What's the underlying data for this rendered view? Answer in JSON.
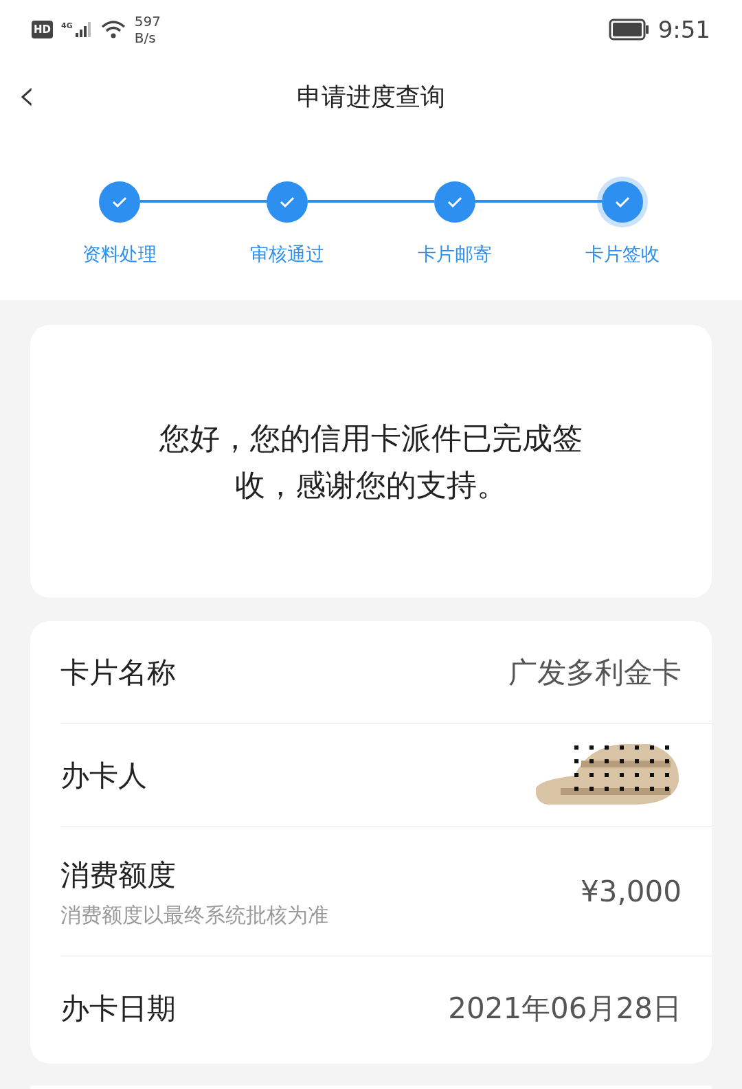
{
  "status_bar": {
    "hd": "HD",
    "network": "4G",
    "speed": "597",
    "speed_unit": "B/s",
    "time": "9:51"
  },
  "header": {
    "back": "‹",
    "title": "申请进度查询"
  },
  "steps": [
    {
      "label": "资料处理",
      "done": true,
      "current": false
    },
    {
      "label": "审核通过",
      "done": true,
      "current": false
    },
    {
      "label": "卡片邮寄",
      "done": true,
      "current": false
    },
    {
      "label": "卡片签收",
      "done": true,
      "current": true
    }
  ],
  "message": "您好，您的信用卡派件已完成签收，感谢您的支持。",
  "details": [
    {
      "kind": "text",
      "label": "卡片名称",
      "value": "广发多利金卡"
    },
    {
      "kind": "redacted",
      "label": "办卡人"
    },
    {
      "kind": "text",
      "label": "消费额度",
      "note": "消费额度以最终系统批核为准",
      "value": "¥3,000"
    },
    {
      "kind": "text",
      "label": "办卡日期",
      "value": "2021年06月28日"
    }
  ]
}
